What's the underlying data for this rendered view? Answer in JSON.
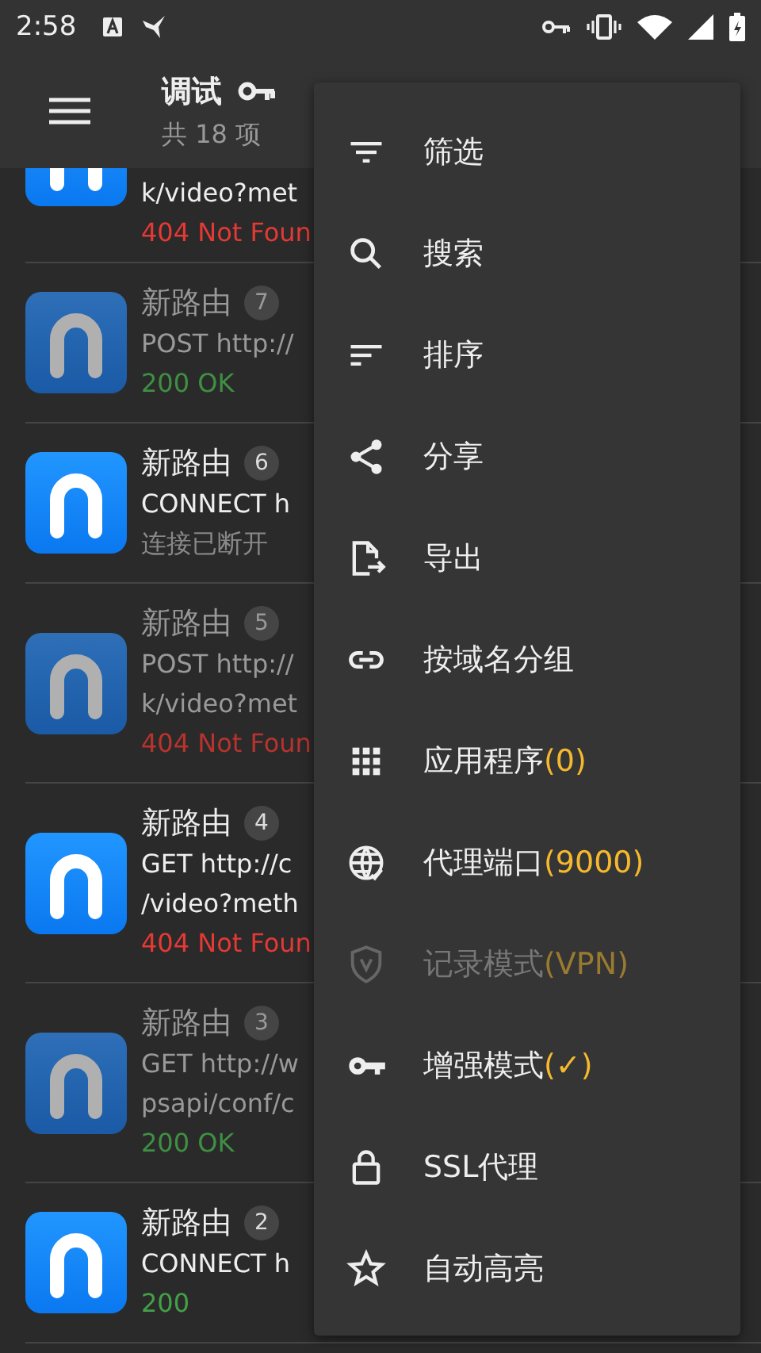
{
  "status_bar": {
    "time": "2:58"
  },
  "header": {
    "title": "调试",
    "subtitle": "共 18 项"
  },
  "requests": [
    {
      "partial": true,
      "faded": false,
      "lines": [
        "k/video?met"
      ],
      "status": "404 Not Foun",
      "color": "#e53935"
    },
    {
      "partial": false,
      "faded": true,
      "title": "新路由",
      "count": "7",
      "lines": [
        "POST http://"
      ],
      "status": "200 OK",
      "color": "#3f8f43"
    },
    {
      "partial": false,
      "faded": false,
      "title": "新路由",
      "count": "6",
      "lines": [
        "CONNECT h"
      ],
      "status": "连接已断开",
      "color": "#888888"
    },
    {
      "partial": false,
      "faded": true,
      "title": "新路由",
      "count": "5",
      "lines": [
        "POST http://",
        "k/video?met"
      ],
      "status": "404 Not Foun",
      "color": "#b8332e"
    },
    {
      "partial": false,
      "faded": false,
      "title": "新路由",
      "count": "4",
      "lines": [
        "GET http://c",
        "/video?meth"
      ],
      "status": "404 Not Foun",
      "color": "#e53935"
    },
    {
      "partial": false,
      "faded": true,
      "title": "新路由",
      "count": "3",
      "lines": [
        "GET http://w",
        "psapi/conf/c"
      ],
      "status": "200 OK",
      "color": "#3f8f43"
    },
    {
      "partial": false,
      "faded": false,
      "title": "新路由",
      "count": "2",
      "lines": [
        "CONNECT h"
      ],
      "status": "200",
      "color": "#43a047"
    }
  ],
  "menu": [
    {
      "kind": "filter",
      "label": "筛选",
      "disabled": false
    },
    {
      "kind": "search",
      "label": "搜索",
      "disabled": false
    },
    {
      "kind": "sort",
      "label": "排序",
      "disabled": false
    },
    {
      "kind": "share",
      "label": "分享",
      "disabled": false
    },
    {
      "kind": "export",
      "label": "导出",
      "disabled": false
    },
    {
      "kind": "link",
      "label": "按域名分组",
      "disabled": false
    },
    {
      "kind": "apps",
      "label": "应用程序",
      "value": "(0)",
      "disabled": false
    },
    {
      "kind": "globe",
      "label": "代理端口",
      "value": "(9000)",
      "disabled": false
    },
    {
      "kind": "shield",
      "label": "记录模式",
      "value": "(VPN)",
      "disabled": true
    },
    {
      "kind": "key",
      "label": "增强模式",
      "value": "(✓)",
      "disabled": false
    },
    {
      "kind": "lock",
      "label": "SSL代理",
      "disabled": false
    },
    {
      "kind": "star",
      "label": "自动高亮",
      "disabled": false
    }
  ]
}
